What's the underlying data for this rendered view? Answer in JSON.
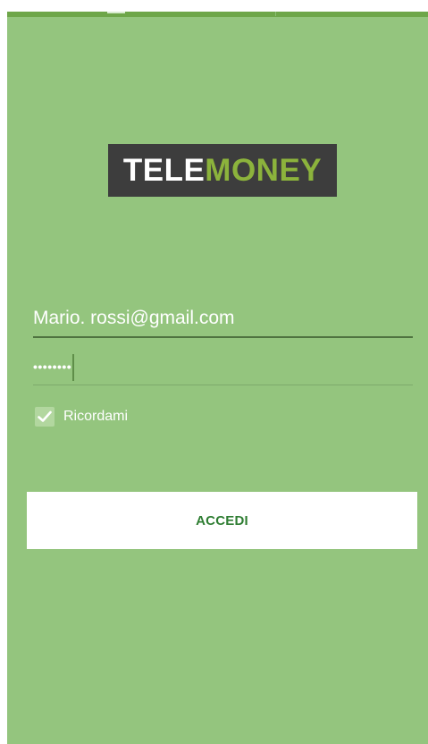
{
  "logo": {
    "part1": "TELE",
    "part2": "MONEY"
  },
  "login_form": {
    "email_value": "Mario. rossi@gmail.com",
    "password_value": "••••••••",
    "remember_label": "Ricordami",
    "remember_checked": true,
    "submit_label": "ACCEDI"
  },
  "colors": {
    "background": "#94c57e",
    "logo_bg": "#3d3d3d",
    "logo_accent": "#8cb33c",
    "button_text": "#2e7d32"
  },
  "icons": {
    "checkbox": "checkmark-icon"
  }
}
